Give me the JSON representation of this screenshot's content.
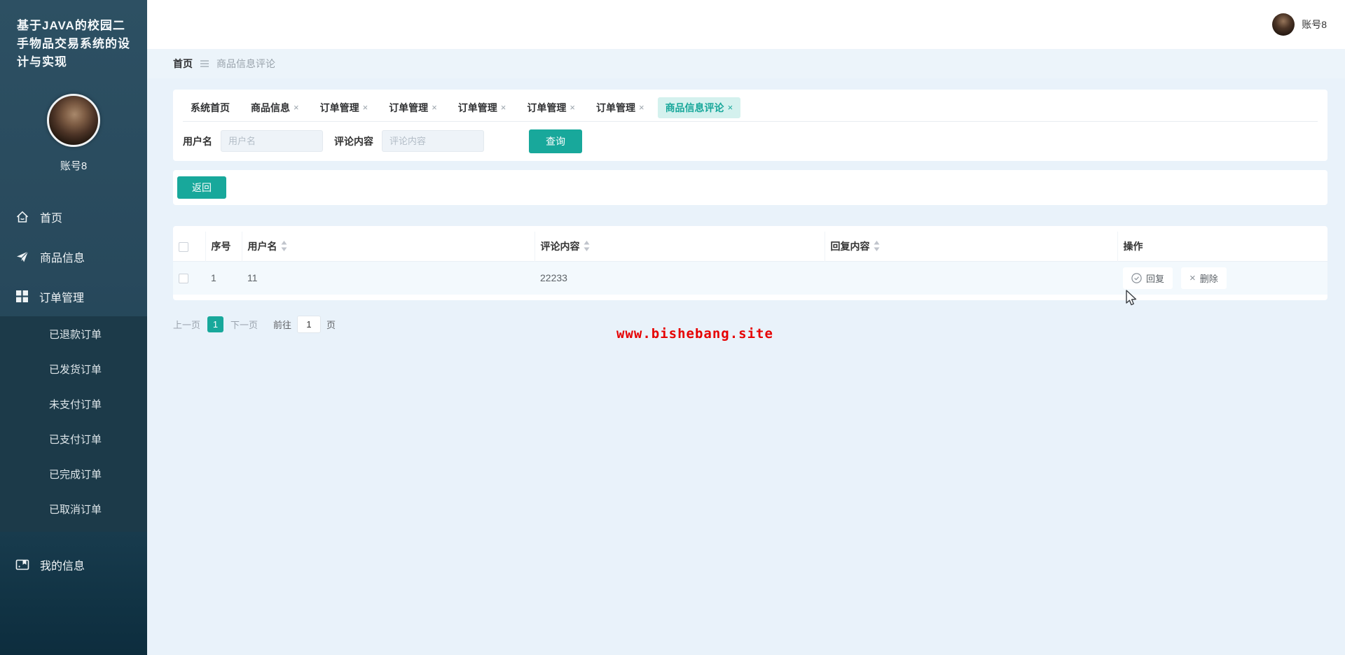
{
  "colors": {
    "accent": "#18a89b",
    "sidebar_bg": "#28495c",
    "submenu_bg": "#1c3a49",
    "active_tab_bg": "#d4f1ee",
    "content_bg": "#e9f2fa",
    "watermark_red": "#e60000"
  },
  "icons": {
    "close": "×"
  },
  "sidebar": {
    "title_lines": [
      "基于JAVA的校园二",
      "手物品交易系统的设",
      "计与实现"
    ],
    "account_name": "账号8",
    "home": "首页",
    "product_info": "商品信息",
    "order_manage": "订单管理",
    "order_submenu": [
      "已退款订单",
      "已发货订单",
      "未支付订单",
      "已支付订单",
      "已完成订单",
      "已取消订单"
    ],
    "my_info": "我的信息"
  },
  "topbar": {
    "account_name": "账号8"
  },
  "breadcrumb": {
    "home": "首页",
    "current": "商品信息评论"
  },
  "tabs": [
    {
      "label": "系统首页"
    },
    {
      "label": "商品信息"
    },
    {
      "label": "订单管理"
    },
    {
      "label": "订单管理"
    },
    {
      "label": "订单管理"
    },
    {
      "label": "订单管理"
    },
    {
      "label": "订单管理"
    },
    {
      "label": "商品信息评论"
    }
  ],
  "search": {
    "username_label": "用户名",
    "username_placeholder": "用户名",
    "comment_label": "评论内容",
    "comment_placeholder": "评论内容",
    "search_button": "查询"
  },
  "toolbar": {
    "back_button": "返回"
  },
  "table": {
    "columns": {
      "index": "序号",
      "username": "用户名",
      "comment": "评论内容",
      "reply": "回复内容",
      "actions": "操作"
    },
    "rows": [
      {
        "index": "1",
        "username": "11",
        "comment": "22233",
        "reply": "",
        "reply_action": "回复",
        "delete_action": "删除"
      }
    ]
  },
  "pagination": {
    "prev": "上一页",
    "page": "1",
    "next": "下一页",
    "goto_label": "前往",
    "goto_value": "1",
    "unit_label": "页"
  },
  "watermark": "www.bishebang.site"
}
